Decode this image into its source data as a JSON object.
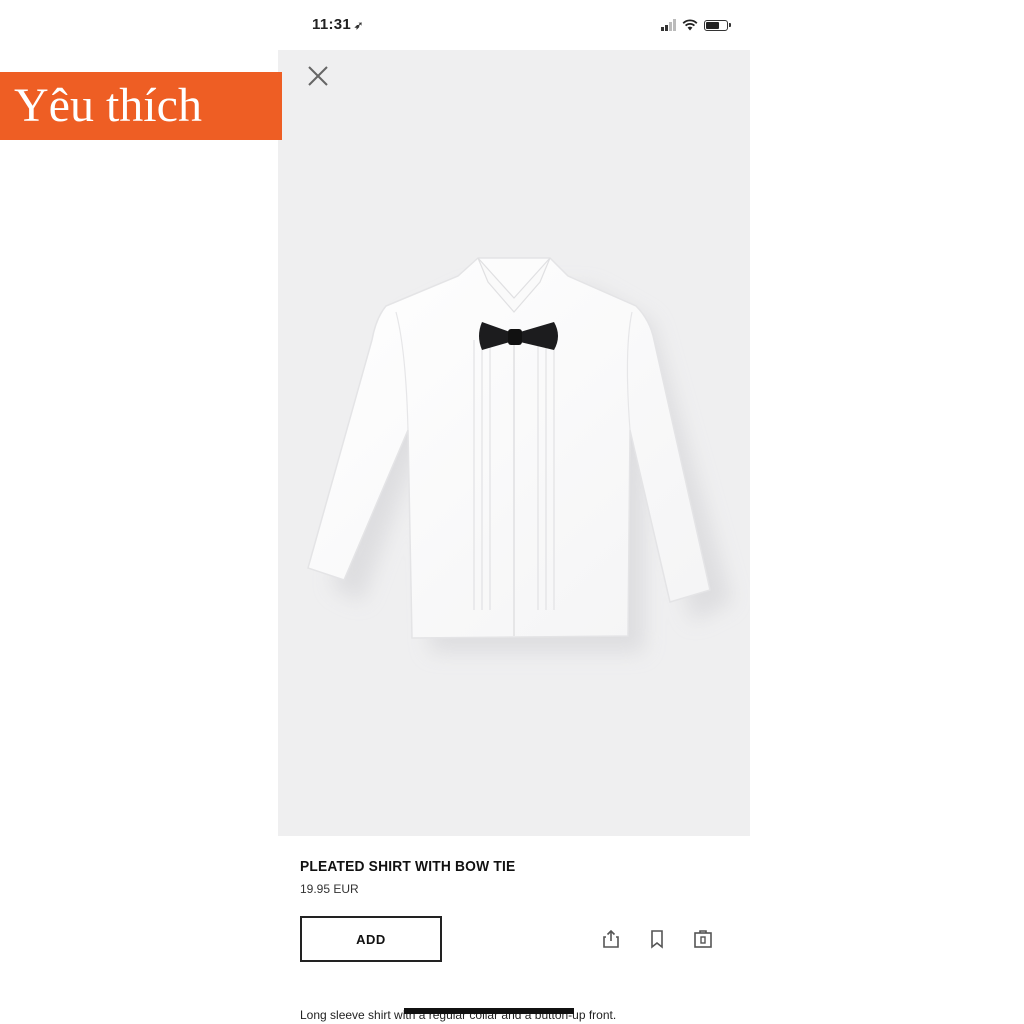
{
  "status_bar": {
    "time": "11:31",
    "location_glyph": "➶",
    "signal_bars": 4,
    "signal_bars_on": 2,
    "battery_level": 0.7
  },
  "badge": {
    "text": "Yêu thích",
    "color": "#ee5e24"
  },
  "product": {
    "title": "PLEATED SHIRT WITH BOW TIE",
    "price": "19.95 EUR",
    "add_label": "ADD",
    "description": "Long sleeve shirt with a regular collar and a button-up front."
  },
  "icons": {
    "close": "close-icon",
    "share": "share-icon",
    "bookmark": "bookmark-icon",
    "store": "store-icon"
  },
  "colors": {
    "image_background": "#efeff0",
    "text": "#111111"
  }
}
